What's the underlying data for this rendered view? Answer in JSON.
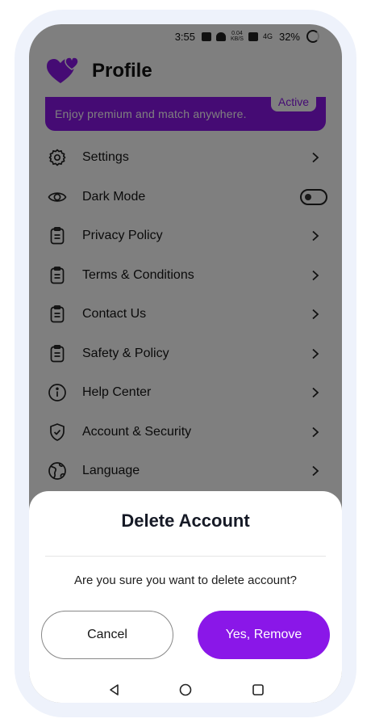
{
  "status_bar": {
    "time": "3:55",
    "network_speed_value": "0.04",
    "network_speed_unit": "KB/S",
    "network_type": "4G",
    "battery": "32%"
  },
  "header": {
    "title": "Profile"
  },
  "premium_banner": {
    "text": "Enjoy  premium and match anywhere.",
    "badge": "Active"
  },
  "menu": {
    "items": [
      {
        "label": "Settings",
        "icon": "gear-icon"
      },
      {
        "label": "Dark Mode",
        "icon": "eye-icon",
        "toggle_on": false
      },
      {
        "label": "Privacy Policy",
        "icon": "clipboard-icon"
      },
      {
        "label": "Terms & Conditions",
        "icon": "clipboard-icon"
      },
      {
        "label": "Contact Us",
        "icon": "clipboard-icon"
      },
      {
        "label": "Safety & Policy",
        "icon": "clipboard-icon"
      },
      {
        "label": "Help Center",
        "icon": "info-icon"
      },
      {
        "label": "Account & Security",
        "icon": "shield-check-icon"
      },
      {
        "label": "Language",
        "icon": "globe-icon"
      }
    ]
  },
  "dialog": {
    "title": "Delete Account",
    "message": "Are you sure you want to delete account?",
    "cancel_label": "Cancel",
    "confirm_label": "Yes, Remove"
  },
  "colors": {
    "accent": "#8A17E8",
    "overlay": "rgba(0,0,0,0.5)",
    "text": "#161A26"
  }
}
